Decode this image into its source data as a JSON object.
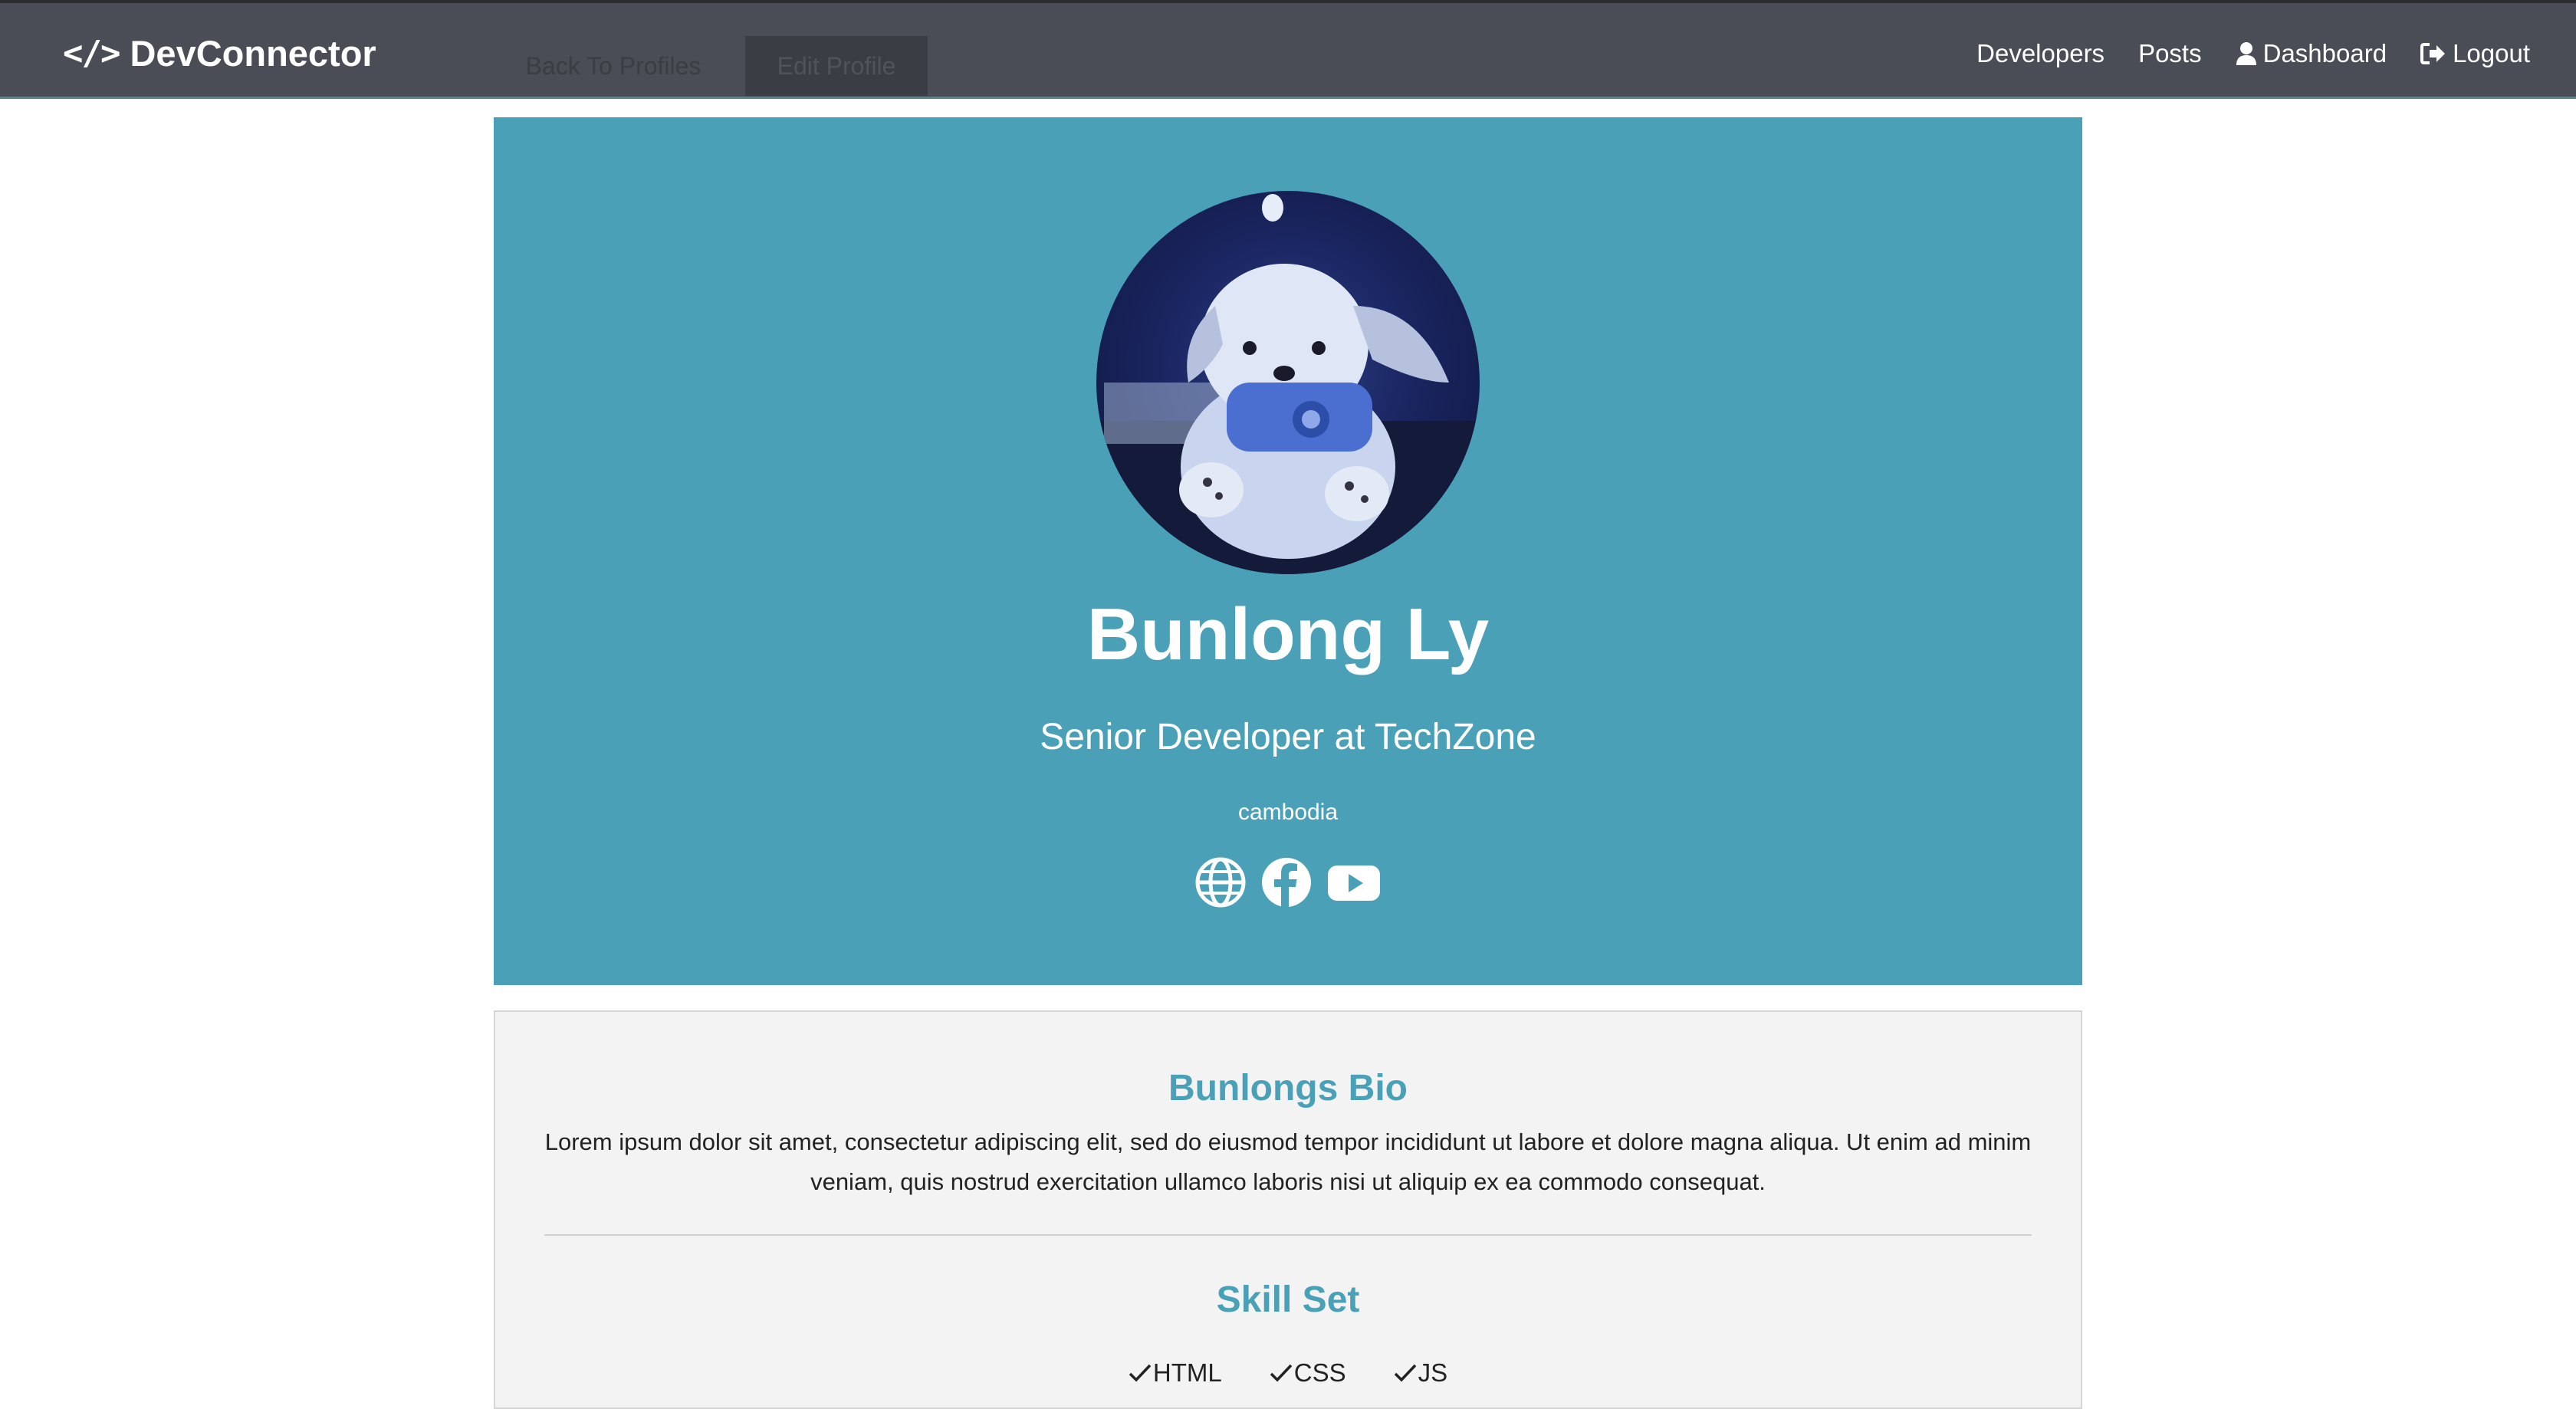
{
  "navbar": {
    "brand": "DevConnector",
    "brand_icon": "code-icon",
    "links": [
      {
        "label": "Developers"
      },
      {
        "label": "Posts"
      },
      {
        "label": "Dashboard",
        "icon": "user-icon"
      },
      {
        "label": "Logout",
        "icon": "logout-icon"
      }
    ]
  },
  "actions": {
    "back_label": "Back To Profiles",
    "edit_label": "Edit Profile"
  },
  "profile": {
    "name": "Bunlong Ly",
    "status": "Senior Developer at TechZone",
    "location": "cambodia",
    "avatar_icon": "plush-toy-avatar",
    "social": [
      "globe-icon",
      "facebook-icon",
      "youtube-icon"
    ],
    "accent_color": "#4aa1b7"
  },
  "about": {
    "bio_title": "Bunlongs Bio",
    "bio_text": "Lorem ipsum dolor sit amet, consectetur adipiscing elit, sed do eiusmod tempor incididunt ut labore et dolore magna aliqua. Ut enim ad minim veniam, quis nostrud exercitation ullamco laboris nisi ut aliquip ex ea commodo consequat.",
    "skills_title": "Skill Set",
    "skills": [
      "HTML",
      "CSS",
      "JS"
    ]
  }
}
